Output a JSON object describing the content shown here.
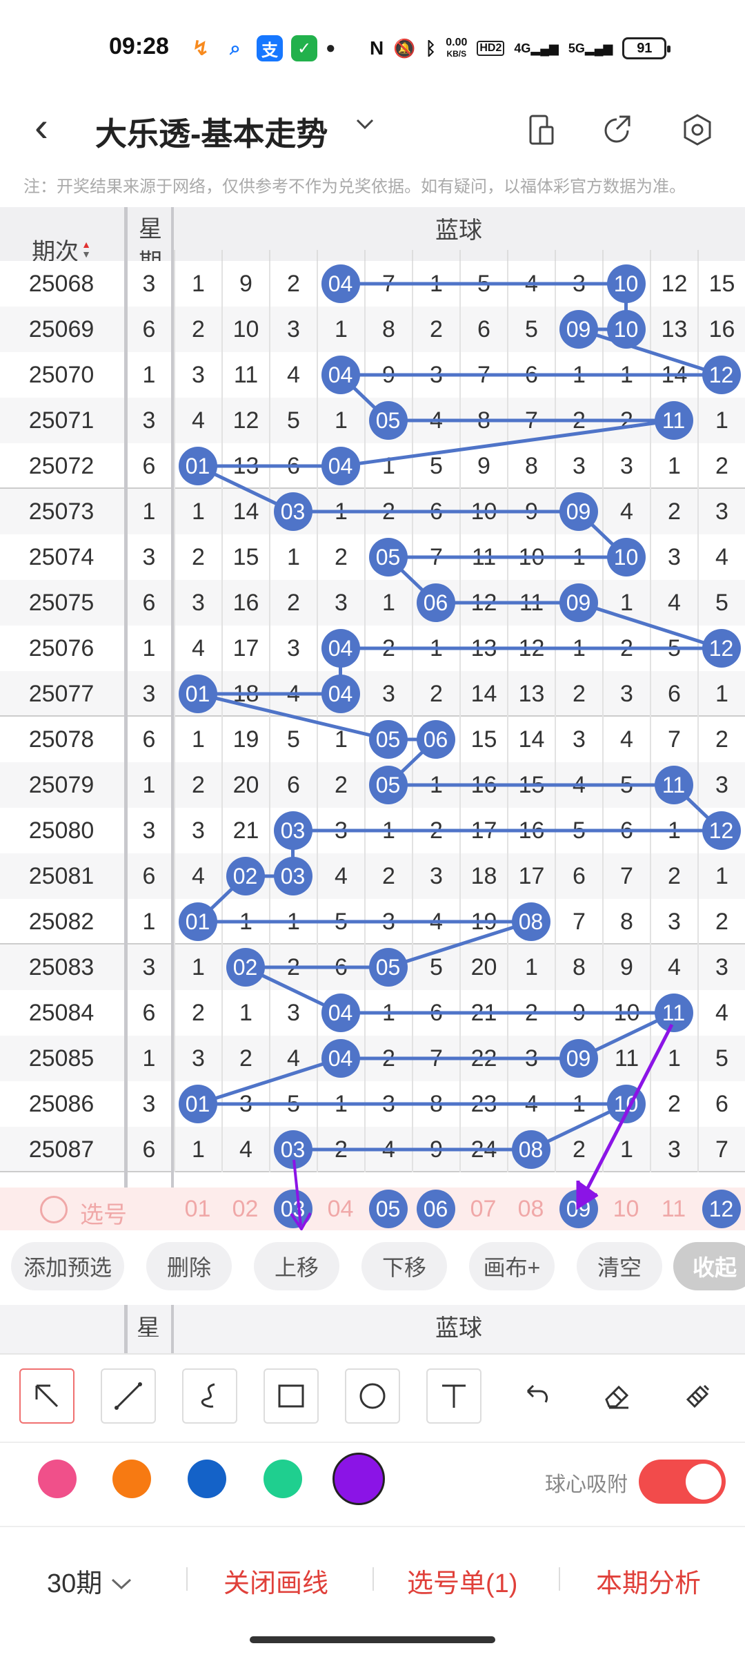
{
  "status_bar": {
    "time": "09:28",
    "net_speed": "0.00",
    "net_unit": "KB/S",
    "hd": "HD2",
    "sig1": "4G",
    "sig2": "5G",
    "battery": "91"
  },
  "header": {
    "title": "大乐透-基本走势",
    "icons": [
      "back-icon",
      "chevron-down-icon",
      "phone-split-icon",
      "share-icon",
      "settings-icon"
    ]
  },
  "note": "注：开奖结果来源于网络，仅供参考不作为兑奖依据。如有疑问，以福体彩官方数据为准。",
  "table": {
    "col_period": "期次",
    "col_week": "星期",
    "col_blue": "蓝球",
    "numbers": [
      "01",
      "02",
      "03",
      "04",
      "05",
      "06",
      "07",
      "08",
      "09",
      "10",
      "11",
      "12"
    ],
    "rows": [
      {
        "period": "25068",
        "week": "3",
        "cells": [
          "1",
          "9",
          "2",
          "04",
          "7",
          "1",
          "5",
          "4",
          "3",
          "10",
          "12",
          "15"
        ],
        "hits": [
          4,
          10
        ]
      },
      {
        "period": "25069",
        "week": "6",
        "cells": [
          "2",
          "10",
          "3",
          "1",
          "8",
          "2",
          "6",
          "5",
          "09",
          "10",
          "13",
          "16"
        ],
        "hits": [
          9,
          10
        ]
      },
      {
        "period": "25070",
        "week": "1",
        "cells": [
          "3",
          "11",
          "4",
          "04",
          "9",
          "3",
          "7",
          "6",
          "1",
          "1",
          "14",
          "12"
        ],
        "hits": [
          4,
          12
        ]
      },
      {
        "period": "25071",
        "week": "3",
        "cells": [
          "4",
          "12",
          "5",
          "1",
          "05",
          "4",
          "8",
          "7",
          "2",
          "2",
          "11",
          "1"
        ],
        "hits": [
          5,
          11
        ]
      },
      {
        "period": "25072",
        "week": "6",
        "cells": [
          "01",
          "13",
          "6",
          "04",
          "1",
          "5",
          "9",
          "8",
          "3",
          "3",
          "1",
          "2"
        ],
        "hits": [
          1,
          4
        ]
      },
      {
        "period": "25073",
        "week": "1",
        "cells": [
          "1",
          "14",
          "03",
          "1",
          "2",
          "6",
          "10",
          "9",
          "09",
          "4",
          "2",
          "3"
        ],
        "hits": [
          3,
          9
        ]
      },
      {
        "period": "25074",
        "week": "3",
        "cells": [
          "2",
          "15",
          "1",
          "2",
          "05",
          "7",
          "11",
          "10",
          "1",
          "10",
          "3",
          "4"
        ],
        "hits": [
          5,
          10
        ]
      },
      {
        "period": "25075",
        "week": "6",
        "cells": [
          "3",
          "16",
          "2",
          "3",
          "1",
          "06",
          "12",
          "11",
          "09",
          "1",
          "4",
          "5"
        ],
        "hits": [
          6,
          9
        ]
      },
      {
        "period": "25076",
        "week": "1",
        "cells": [
          "4",
          "17",
          "3",
          "04",
          "2",
          "1",
          "13",
          "12",
          "1",
          "2",
          "5",
          "12"
        ],
        "hits": [
          4,
          12
        ]
      },
      {
        "period": "25077",
        "week": "3",
        "cells": [
          "01",
          "18",
          "4",
          "04",
          "3",
          "2",
          "14",
          "13",
          "2",
          "3",
          "6",
          "1"
        ],
        "hits": [
          1,
          4
        ]
      },
      {
        "period": "25078",
        "week": "6",
        "cells": [
          "1",
          "19",
          "5",
          "1",
          "05",
          "06",
          "15",
          "14",
          "3",
          "4",
          "7",
          "2"
        ],
        "hits": [
          5,
          6
        ]
      },
      {
        "period": "25079",
        "week": "1",
        "cells": [
          "2",
          "20",
          "6",
          "2",
          "05",
          "1",
          "16",
          "15",
          "4",
          "5",
          "11",
          "3"
        ],
        "hits": [
          5,
          11
        ]
      },
      {
        "period": "25080",
        "week": "3",
        "cells": [
          "3",
          "21",
          "03",
          "3",
          "1",
          "2",
          "17",
          "16",
          "5",
          "6",
          "1",
          "12"
        ],
        "hits": [
          3,
          12
        ]
      },
      {
        "period": "25081",
        "week": "6",
        "cells": [
          "4",
          "02",
          "03",
          "4",
          "2",
          "3",
          "18",
          "17",
          "6",
          "7",
          "2",
          "1"
        ],
        "hits": [
          2,
          3
        ]
      },
      {
        "period": "25082",
        "week": "1",
        "cells": [
          "01",
          "1",
          "1",
          "5",
          "3",
          "4",
          "19",
          "08",
          "7",
          "8",
          "3",
          "2"
        ],
        "hits": [
          1,
          8
        ]
      },
      {
        "period": "25083",
        "week": "3",
        "cells": [
          "1",
          "02",
          "2",
          "6",
          "05",
          "5",
          "20",
          "1",
          "8",
          "9",
          "4",
          "3"
        ],
        "hits": [
          2,
          5
        ]
      },
      {
        "period": "25084",
        "week": "6",
        "cells": [
          "2",
          "1",
          "3",
          "04",
          "1",
          "6",
          "21",
          "2",
          "9",
          "10",
          "11",
          "4"
        ],
        "hits": [
          4,
          11
        ]
      },
      {
        "period": "25085",
        "week": "1",
        "cells": [
          "3",
          "2",
          "4",
          "04",
          "2",
          "7",
          "22",
          "3",
          "09",
          "11",
          "1",
          "5"
        ],
        "hits": [
          4,
          9
        ]
      },
      {
        "period": "25086",
        "week": "3",
        "cells": [
          "01",
          "3",
          "5",
          "1",
          "3",
          "8",
          "23",
          "4",
          "1",
          "10",
          "2",
          "6"
        ],
        "hits": [
          1,
          10
        ]
      },
      {
        "period": "25087",
        "week": "6",
        "cells": [
          "1",
          "4",
          "03",
          "2",
          "4",
          "9",
          "24",
          "08",
          "2",
          "1",
          "3",
          "7"
        ],
        "hits": [
          3,
          8
        ]
      }
    ],
    "select_label": "选号",
    "selected": [
      3,
      5,
      6,
      9,
      12
    ]
  },
  "actions": [
    "添加预选",
    "删除",
    "上移",
    "下移",
    "画布+",
    "清空",
    "收起"
  ],
  "draw_tools": [
    "arrow-tool-icon",
    "line-tool-icon",
    "curve-tool-icon",
    "rect-tool-icon",
    "circle-tool-icon",
    "text-tool-icon",
    "undo-icon",
    "eraser-icon",
    "brush-icon"
  ],
  "colors": [
    "#f0508a",
    "#f77a12",
    "#1462c8",
    "#1fcf8f",
    "#8b14e6"
  ],
  "snap": {
    "label": "球心吸附",
    "on": true
  },
  "bottom": {
    "periods": "30期",
    "close": "关闭画线",
    "list": "选号单(1)",
    "analysis": "本期分析"
  }
}
